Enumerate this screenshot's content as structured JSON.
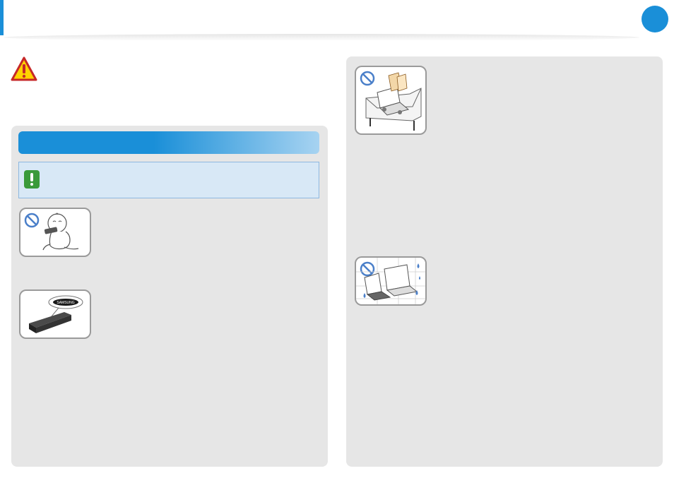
{
  "header": {
    "page_badge_label": ""
  },
  "colors": {
    "accent": "#1a8fd8",
    "panel": "#e6e6e6",
    "notice_bg": "#d8e8f6",
    "notice_icon": "#3a9a3a",
    "warning_red": "#c62828",
    "warning_yellow": "#ffd200"
  },
  "icons": [
    "warning-triangle-icon",
    "notice-exclamation-icon",
    "prohibited-icon"
  ],
  "left_panel": {
    "section_title": "",
    "notice_text": "",
    "illustrations": [
      "baby-chewing-battery-illustration",
      "samsung-battery-illustration"
    ]
  },
  "right_panel": {
    "illustrations": [
      "laptop-on-sofa-illustration",
      "laptop-in-wet-place-illustration"
    ]
  },
  "battery_label": "SAMSUNG"
}
